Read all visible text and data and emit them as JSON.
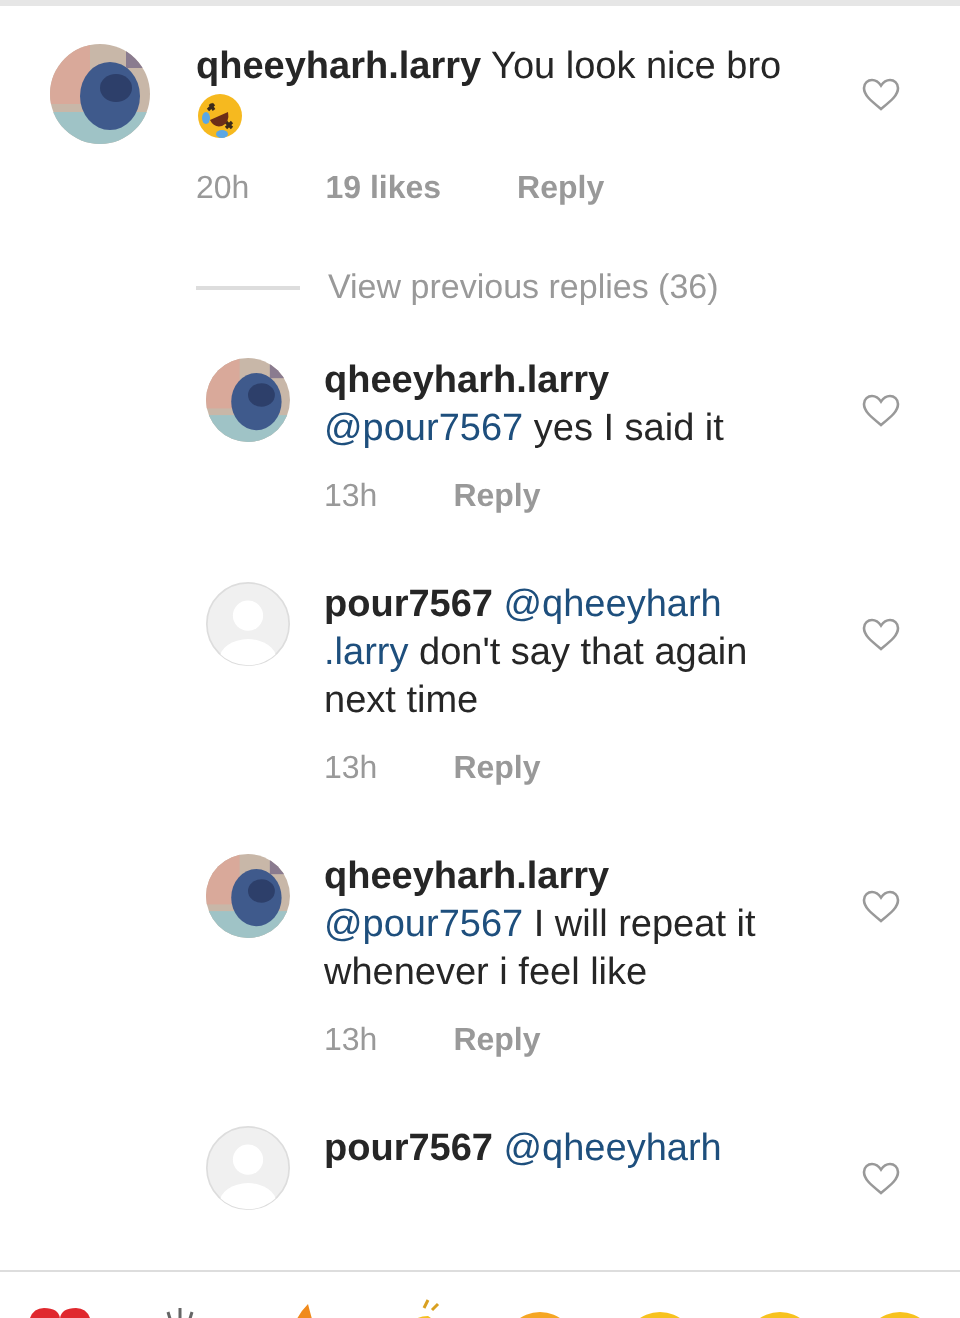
{
  "comment": {
    "username": "qheeyharh.larry",
    "text": "You look nice bro",
    "avatar": {
      "kind": "photo"
    },
    "time": "20h",
    "likes": "19 likes",
    "reply": "Reply"
  },
  "view_previous": "View previous replies (36)",
  "replies": [
    {
      "username": "qheeyharh.larry",
      "mention": [
        "@pour7567"
      ],
      "text": "yes I said it",
      "avatar": {
        "kind": "photo"
      },
      "time": "13h",
      "reply": "Reply"
    },
    {
      "username": "pour7567",
      "mention": [
        "@qheeyharh",
        ".larry"
      ],
      "text": "don't say that again next time",
      "avatar": {
        "kind": "default"
      },
      "time": "13h",
      "reply": "Reply"
    },
    {
      "username": "qheeyharh.larry",
      "mention": [
        "@pour7567"
      ],
      "text": "I will repeat it whenever i feel like",
      "avatar": {
        "kind": "photo"
      },
      "time": "13h",
      "reply": "Reply"
    },
    {
      "username": "pour7567",
      "mention": [
        "@qheeyharh"
      ],
      "avatar": {
        "kind": "default"
      }
    }
  ]
}
